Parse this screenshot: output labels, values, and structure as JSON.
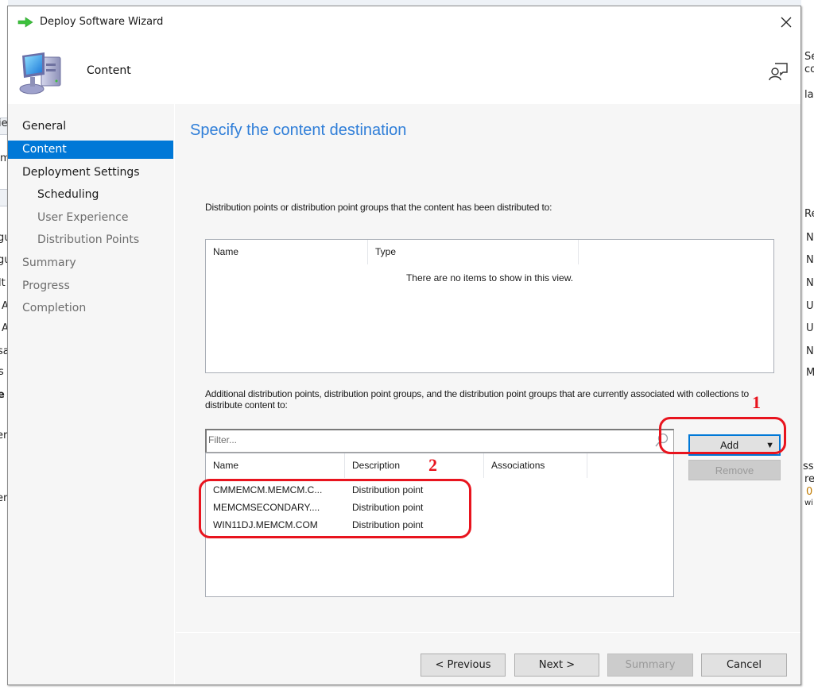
{
  "background": {
    "left_fragments": [
      "ie",
      "m",
      "gu",
      "gu",
      "lt",
      "A",
      "A",
      "sa",
      "s",
      "e",
      "er",
      "er"
    ],
    "right_fragments": [
      "Se",
      "co",
      "la",
      "Re",
      "N",
      "N",
      "N",
      "U",
      "U",
      "N",
      "M",
      "ss",
      "re",
      "0",
      "wi"
    ]
  },
  "dialog": {
    "title": "Deploy Software Wizard",
    "close_label": "×",
    "page_name": "Content",
    "icons": {
      "title": "green-arrow-icon",
      "page": "computer-icon",
      "feedback": "feedback-icon",
      "close": "close-icon"
    }
  },
  "nav": {
    "items": [
      {
        "label": "General",
        "state": "active",
        "level": 0
      },
      {
        "label": "Content",
        "state": "selected",
        "level": 0
      },
      {
        "label": "Deployment Settings",
        "state": "active",
        "level": 0
      },
      {
        "label": "Scheduling",
        "state": "active",
        "level": 1
      },
      {
        "label": "User Experience",
        "state": "inactive",
        "level": 1
      },
      {
        "label": "Distribution Points",
        "state": "inactive",
        "level": 1
      },
      {
        "label": "Summary",
        "state": "inactive",
        "level": 0
      },
      {
        "label": "Progress",
        "state": "inactive",
        "level": 0
      },
      {
        "label": "Completion",
        "state": "inactive",
        "level": 0
      }
    ],
    "selected_color": "#0078d7"
  },
  "main": {
    "title": "Specify the content destination",
    "distributed_label": "Distribution points or distribution point groups that the content has been distributed to:",
    "distributed_table": {
      "columns": [
        "Name",
        "Type",
        ""
      ],
      "empty_message": "There are no items to show in this view."
    },
    "additional_label": "Additional distribution points, distribution point groups, and the distribution point groups that are currently associated with collections to distribute content to:",
    "filter": {
      "placeholder": "Filter...",
      "value": ""
    },
    "additional_table": {
      "columns": [
        "Name",
        "Description",
        "Associations",
        ""
      ],
      "rows": [
        {
          "name": "CMMEMCM.MEMCM.C...",
          "description": "Distribution point",
          "associations": ""
        },
        {
          "name": "MEMCMSECONDARY....",
          "description": "Distribution point",
          "associations": ""
        },
        {
          "name": "WIN11DJ.MEMCM.COM",
          "description": "Distribution point",
          "associations": ""
        }
      ]
    },
    "add_button": {
      "label": "Add",
      "dropdown_glyph": "▼"
    },
    "remove_button": {
      "label": "Remove",
      "enabled": false
    }
  },
  "footer": {
    "previous": "< Previous",
    "next": "Next >",
    "summary": "Summary",
    "summary_enabled": false,
    "cancel": "Cancel"
  },
  "annotations": {
    "marker_1": "1",
    "marker_2": "2",
    "color": "#e8141e"
  }
}
